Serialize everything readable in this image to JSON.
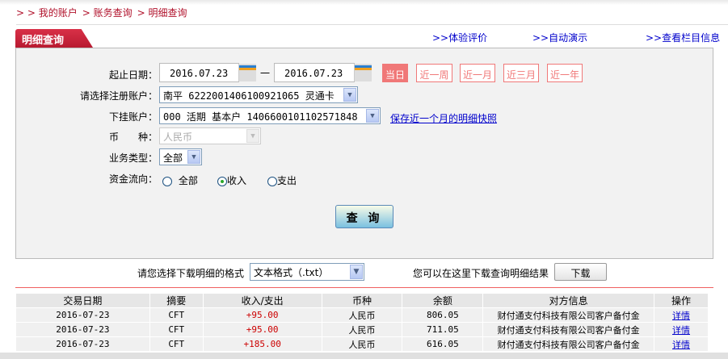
{
  "breadcrumb": [
    "> > 我的账户",
    "> 账务查询",
    "> 明细查询"
  ],
  "tab_title": "明细查询",
  "top_links": [
    ">>体验评价",
    ">>自动演示",
    ">>查看栏目信息"
  ],
  "form": {
    "date_label": "起止日期：",
    "start_date": "2016.07.23",
    "date_sep": "一",
    "end_date": "2016.07.23",
    "quick": [
      "当日",
      "近一周",
      "近一月",
      "近三月",
      "近一年"
    ],
    "reg_account_label": "请选择注册账户：",
    "reg_account": "南平 6222001406100921065 灵通卡",
    "sub_account_label": "下挂账户：",
    "sub_account": "000 活期 基本户 1406600101102571848",
    "snapshot_link": "保存近一个月的明细快照",
    "currency_label": "币　　种：",
    "currency": "人民币",
    "biz_type_label": "业务类型：",
    "biz_type": "全部",
    "flow_label": "资金流向：",
    "flow_options": [
      "全部",
      "收入",
      "支出"
    ],
    "flow_selected": "收入",
    "search_button": "查 询"
  },
  "download": {
    "label": "请您选择下载明细的格式",
    "format": "文本格式（.txt）",
    "hint": "您可以在这里下载查询明细结果",
    "button": "下载"
  },
  "table": {
    "headers": [
      "交易日期",
      "摘要",
      "收入/支出",
      "币种",
      "余额",
      "对方信息",
      "操作"
    ],
    "rows": [
      [
        "2016-07-23",
        "CFT",
        "+95.00",
        "人民币",
        "806.05",
        "财付通支付科技有限公司客户备付金",
        "详情"
      ],
      [
        "2016-07-23",
        "CFT",
        "+95.00",
        "人民币",
        "711.05",
        "财付通支付科技有限公司客户备付金",
        "详情"
      ],
      [
        "2016-07-23",
        "CFT",
        "+185.00",
        "人民币",
        "616.05",
        "财付通支付科技有限公司客户备付金",
        "详情"
      ]
    ]
  },
  "colors": {
    "brand": "#b81a30",
    "accent": "#f07878",
    "link": "#0000cc"
  }
}
